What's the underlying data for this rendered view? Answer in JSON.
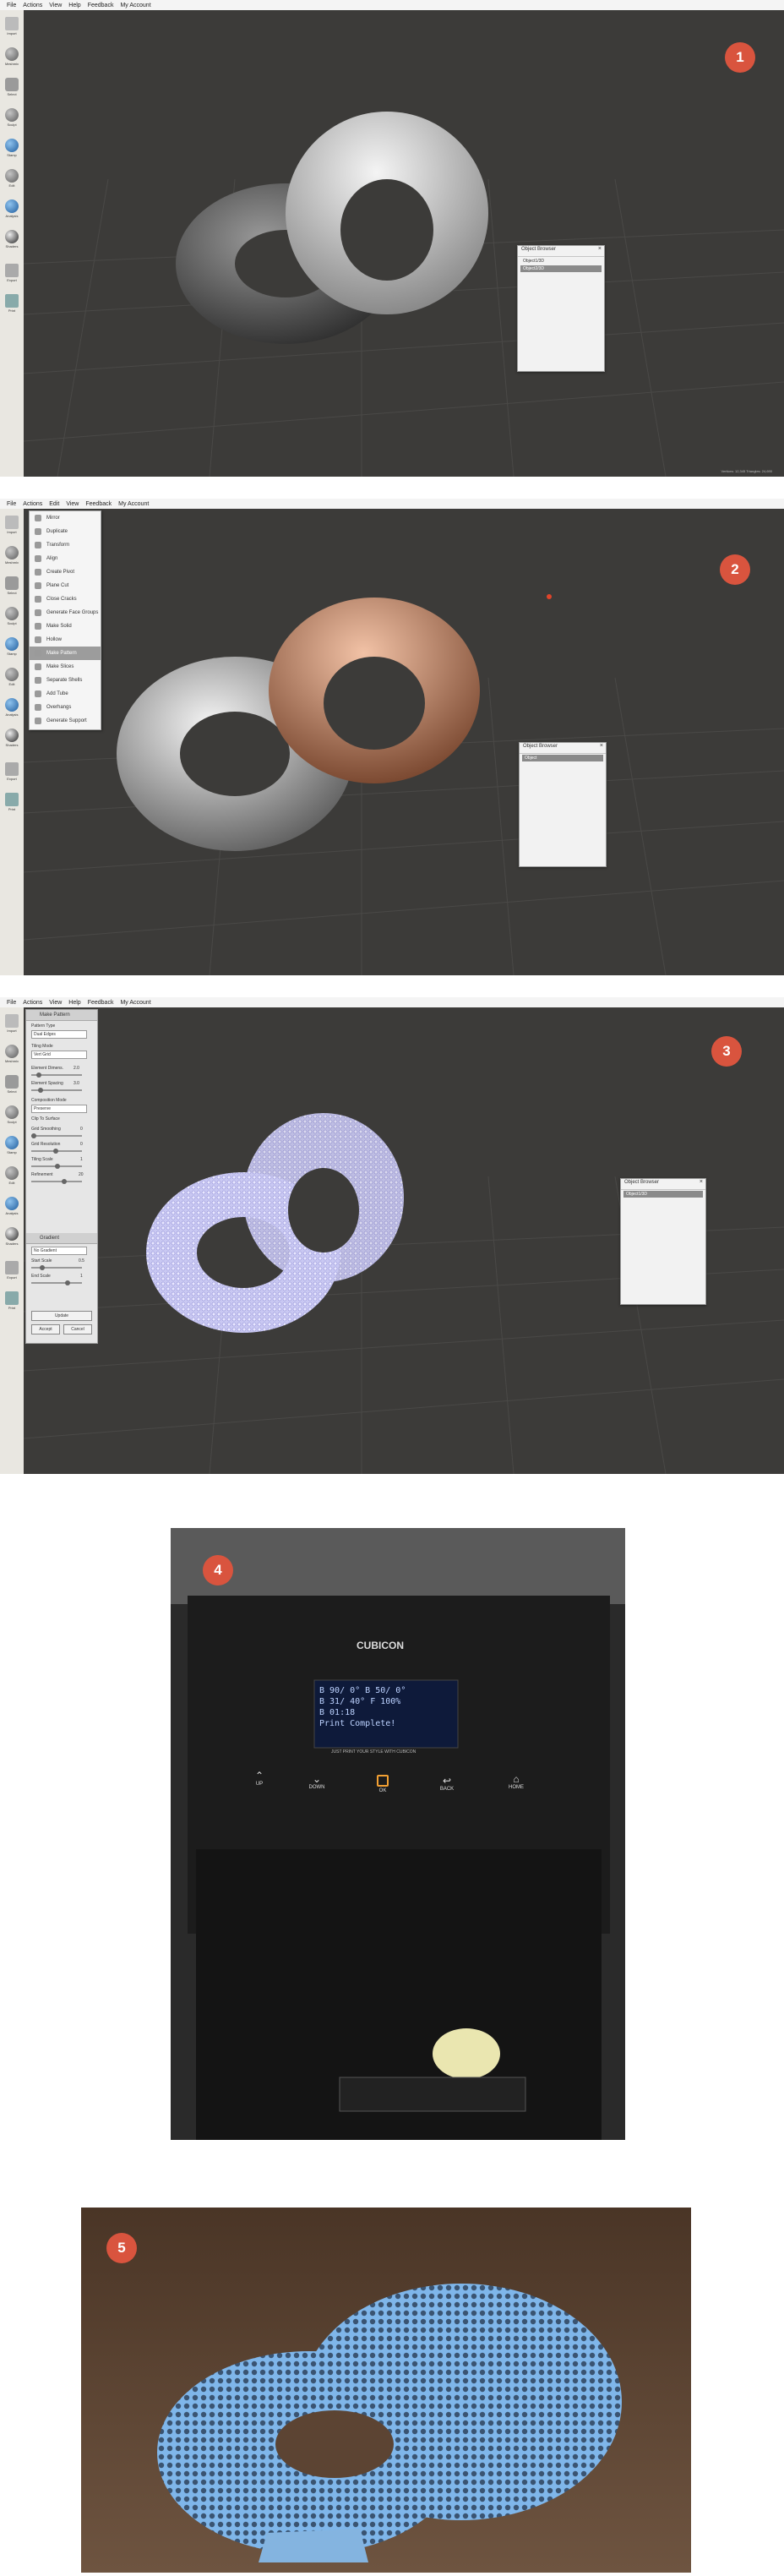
{
  "menus": {
    "one": [
      "File",
      "Actions",
      "View",
      "Help",
      "Feedback",
      "My Account"
    ],
    "two": [
      "File",
      "Actions",
      "Edit",
      "View",
      "Feedback",
      "My Account"
    ],
    "three": [
      "File",
      "Actions",
      "View",
      "Help",
      "Feedback",
      "My Account"
    ]
  },
  "tools": [
    "Import",
    "Meshmix",
    "Select",
    "Sculpt",
    "Stamp",
    "Edit",
    "Analysis",
    "Shaders",
    "Export",
    "Print"
  ],
  "badges": [
    "1",
    "2",
    "3",
    "4",
    "5"
  ],
  "object_browser": {
    "title": "Object Browser",
    "items_one": [
      "Object1/3D",
      "Object2/3D"
    ],
    "items_two": [
      "Object"
    ],
    "items_three": [
      "Object1/3D"
    ]
  },
  "context_menu": {
    "items": [
      "Mirror",
      "Duplicate",
      "Transform",
      "Align",
      "Create Pivot",
      "Plane Cut",
      "Close Cracks",
      "Generate Face Groups",
      "Make Solid",
      "Hollow",
      "Make Pattern",
      "Make Slices",
      "Separate Shells",
      "Add Tube",
      "Overhangs",
      "Generate Support"
    ],
    "highlighted_index": 10
  },
  "make_pattern": {
    "title": "Make Pattern",
    "pattern_type_label": "Pattern Type",
    "pattern_type": "Dual Edges",
    "tiling_mode_label": "Tiling Mode",
    "tiling_mode": "Vert Grid",
    "element_dimension_label": "Element Dimens.",
    "element_dimension": "2.0",
    "element_spacing_label": "Element Spacing",
    "element_spacing": "3.0",
    "composition_mode_label": "Composition Mode",
    "composition_mode": "Preserve",
    "clip_to_surface": "Clip To Surface",
    "grid_smoothing_label": "Grid Smoothing",
    "grid_smoothing": "0",
    "grid_resolution_label": "Grid Resolution",
    "grid_resolution": "0",
    "tiling_scale_label": "Tiling Scale",
    "tiling_scale": "1",
    "refinement_label": "Refinement",
    "refinement": "20",
    "section2_title": "Gradient",
    "gradient_type": "No Gradient",
    "start_scale_label": "Start Scale",
    "start_scale": "0.5",
    "end_scale_label": "End Scale",
    "end_scale": "1",
    "update_label": "Update",
    "accept_label": "Accept",
    "cancel_label": "Cancel"
  },
  "status_text": "Vertices: 12,345  Triangles: 24,690",
  "printer": {
    "brand": "CUBICON",
    "lcd_lines": [
      "B 90/ 0° B 50/ 0°",
      "B 31/ 40° F 100%",
      "B 01:18",
      "Print Complete!"
    ],
    "tagline": "JUST PRINT YOUR STYLE WITH CUBICON",
    "buttons": [
      "UP",
      "DOWN",
      "OK",
      "BACK",
      "HOME"
    ]
  }
}
